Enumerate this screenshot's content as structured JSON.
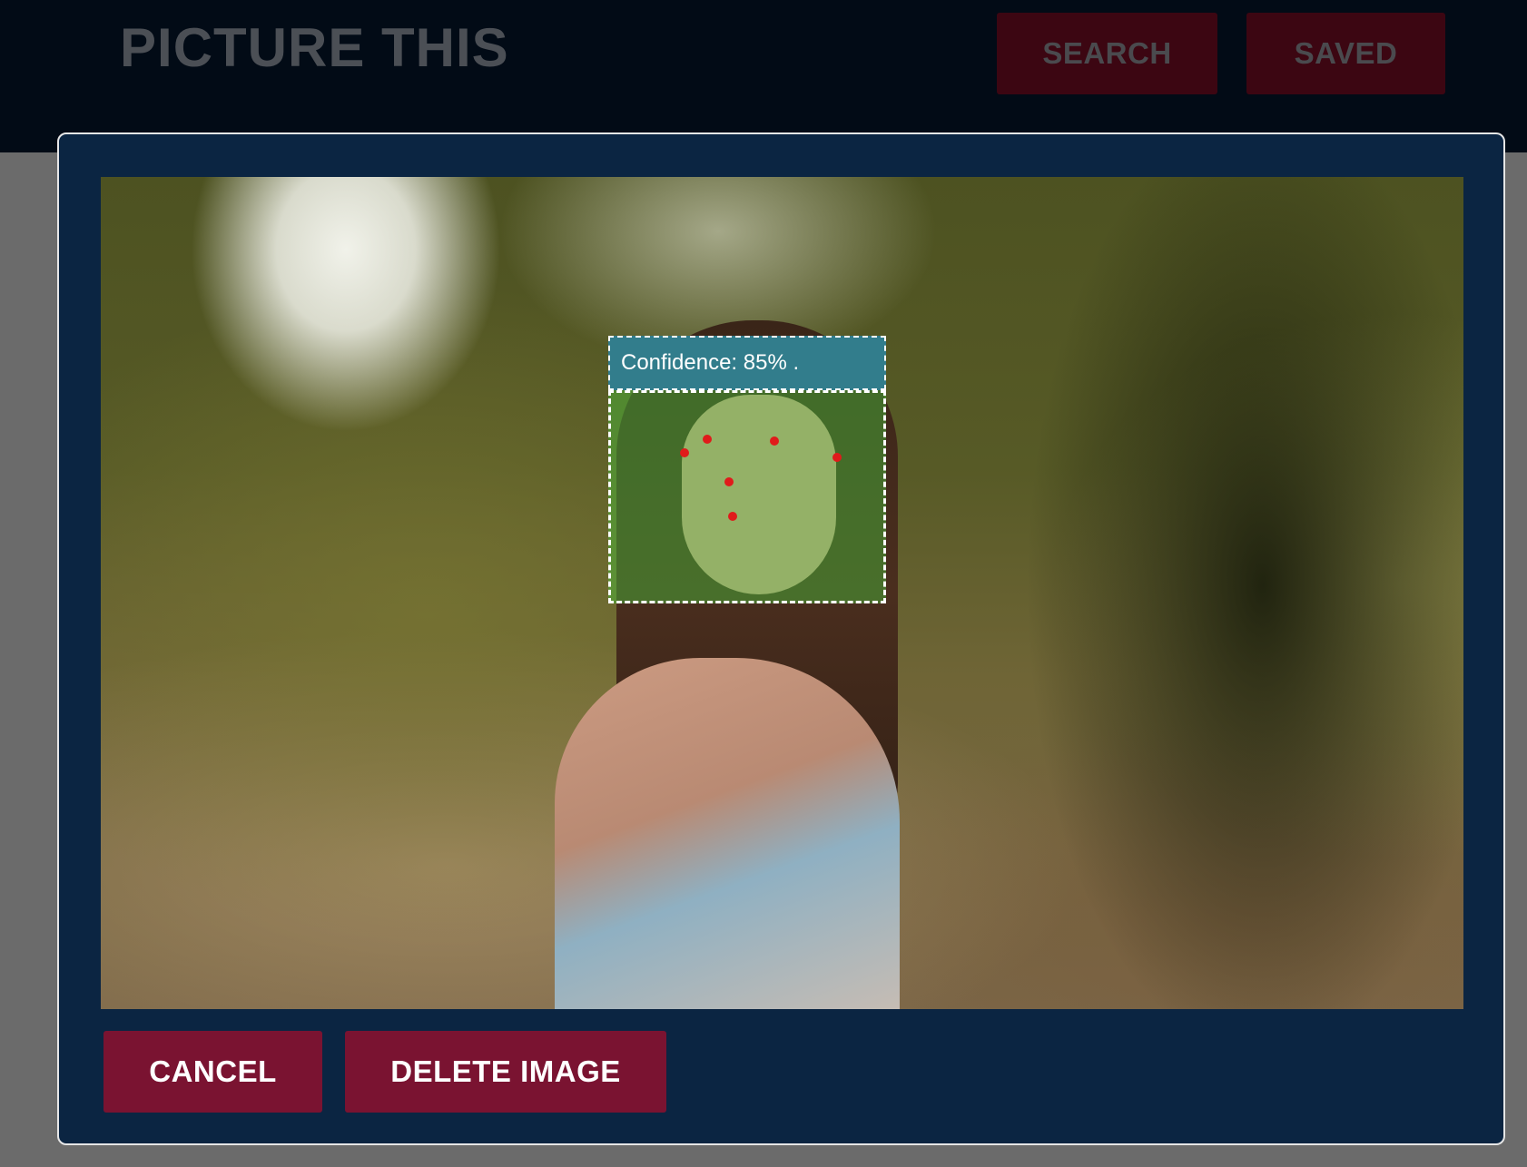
{
  "header": {
    "logo": "PICTURE THIS",
    "nav": {
      "search_label": "SEARCH",
      "saved_label": "SAVED"
    }
  },
  "modal": {
    "detection": {
      "confidence_label": "Confidence: 85% .",
      "highlight_color": "#46be3c",
      "landmark_color": "#e01b1b"
    },
    "actions": {
      "cancel_label": "CANCEL",
      "delete_label": "DELETE IMAGE"
    }
  },
  "colors": {
    "header_bg": "#020b16",
    "modal_bg": "#0b2542",
    "button_bg": "#7a1331",
    "label_bg": "#327d8c",
    "overlay_bg": "#6b6b6b"
  }
}
